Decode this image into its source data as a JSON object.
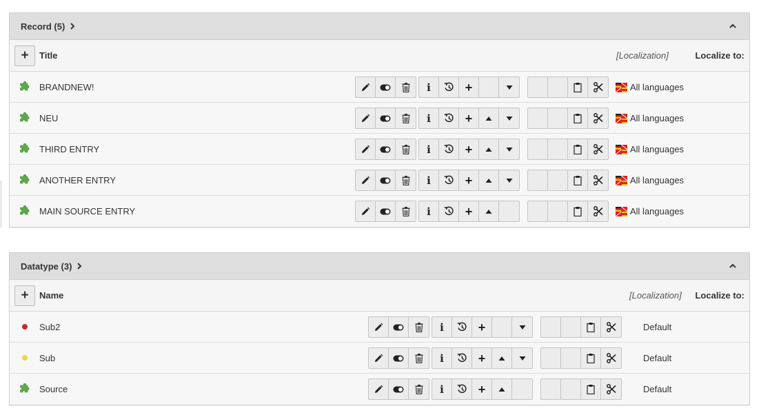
{
  "record_panel": {
    "title": "Record (5)",
    "column_title": "Title",
    "localization_header": "[Localization]",
    "localize_to": "Localize to:",
    "rows": [
      {
        "label": "BRANDNEW!",
        "language": "All languages",
        "up": false,
        "down": true
      },
      {
        "label": "NEU",
        "language": "All languages",
        "up": true,
        "down": true
      },
      {
        "label": "THIRD ENTRY",
        "language": "All languages",
        "up": true,
        "down": true
      },
      {
        "label": "ANOTHER ENTRY",
        "language": "All languages",
        "up": true,
        "down": true
      },
      {
        "label": "MAIN SOURCE ENTRY",
        "language": "All languages",
        "up": true,
        "down": false
      }
    ]
  },
  "datatype_panel": {
    "title": "Datatype (3)",
    "column_title": "Name",
    "localization_header": "[Localization]",
    "localize_to": "Localize to:",
    "rows": [
      {
        "label": "Sub2",
        "language": "Default",
        "icon": "red-dot-icon",
        "up": false,
        "down": true
      },
      {
        "label": "Sub",
        "language": "Default",
        "icon": "yellow-dot-icon",
        "up": true,
        "down": true
      },
      {
        "label": "Source",
        "language": "Default",
        "icon": "puzzle-icon",
        "up": true,
        "down": false
      }
    ]
  },
  "icons": {
    "record_row": "puzzle-icon",
    "flag": "multilingual-flag-icon"
  },
  "colors": {
    "panel_header_bg": "#dedede",
    "row_bg": "#f7f7f7",
    "button_bg": "#ececec",
    "puzzle_green": "#5ea94b",
    "red_dot": "#c8282b",
    "yellow_dot": "#e8d84a"
  }
}
